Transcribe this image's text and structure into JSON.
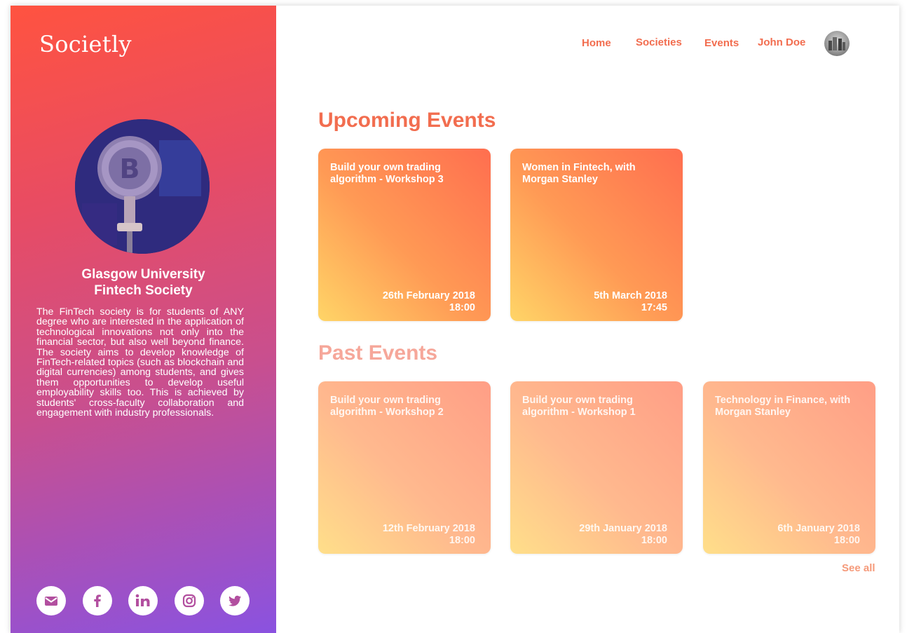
{
  "brand": "Societly",
  "nav": {
    "home": "Home",
    "societies": "Societies",
    "events": "Events",
    "user": "John Doe"
  },
  "society": {
    "title_line1": "Glasgow University",
    "title_line2": "Fintech Society",
    "description": "The FinTech society is for students of ANY degree who are interested in the application of technological innovations not only into the financial sector, but also well beyond finance. The society aims to develop knowledge of FinTech-related topics (such as blockchain and digital currencies) among students, and gives them opportunities to develop useful employability skills too. This is achieved by students' cross-faculty collaboration and engagement with industry professionals."
  },
  "socials": [
    {
      "icon": "mail-icon"
    },
    {
      "icon": "facebook-icon"
    },
    {
      "icon": "linkedin-icon"
    },
    {
      "icon": "instagram-icon"
    },
    {
      "icon": "twitter-icon"
    }
  ],
  "upcoming": {
    "title": "Upcoming Events",
    "events": [
      {
        "name": "Build your own trading algorithm - Workshop 3",
        "date": "26th February 2018",
        "time": "18:00"
      },
      {
        "name": "Women in Fintech, with Morgan Stanley",
        "date": "5th March 2018",
        "time": "17:45"
      }
    ]
  },
  "past": {
    "title": "Past Events",
    "events": [
      {
        "name": "Build your own trading algorithm - Workshop 2",
        "date": "12th February 2018",
        "time": "18:00"
      },
      {
        "name": "Build your own trading algorithm - Workshop 1",
        "date": "29th January 2018",
        "time": "18:00"
      },
      {
        "name": "Technology in Finance, with Morgan Stanley",
        "date": "6th January 2018",
        "time": "18:00"
      }
    ],
    "see_all": "See all"
  },
  "colors": {
    "accent": "#f26d4f",
    "accent_light": "#f6a79a",
    "sidebar_top": "#ff5340",
    "sidebar_bottom": "#8a52e0"
  }
}
